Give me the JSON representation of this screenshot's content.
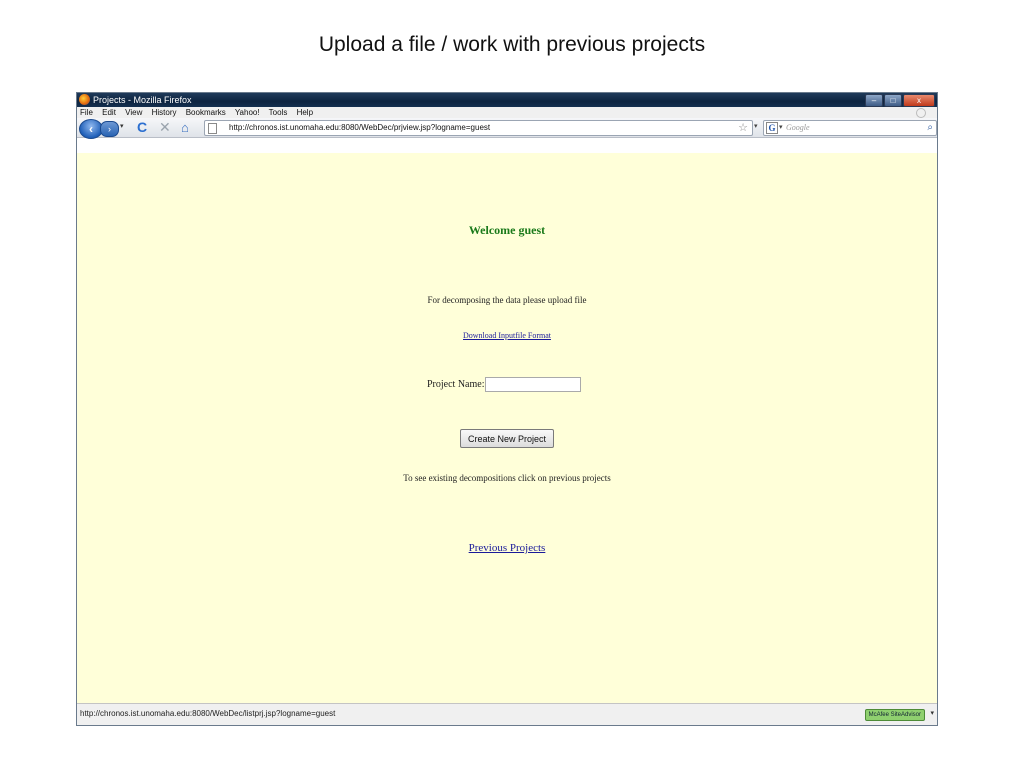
{
  "slide": {
    "title": "Upload a file / work with previous projects"
  },
  "window": {
    "title": "Projects - Mozilla Firefox",
    "controls": {
      "minimize": "–",
      "maximize": "□",
      "close": "x"
    }
  },
  "menubar": {
    "items": [
      "File",
      "Edit",
      "View",
      "History",
      "Bookmarks",
      "Yahoo!",
      "Tools",
      "Help"
    ]
  },
  "navbar": {
    "back": "‹",
    "forward": "›",
    "history": "▾",
    "reload": "C",
    "stop": "✕",
    "home": "⌂",
    "url": "http://chronos.ist.unomaha.edu:8080/WebDec/prjview.jsp?logname=guest",
    "bookmark_star": "☆",
    "url_dropdown": "▾",
    "search_engine": "G",
    "search_dropdown": "▾",
    "search_placeholder": "Google",
    "search_button": "⌕"
  },
  "page": {
    "welcome": "Welcome guest",
    "upload_text": "For decomposing the data please upload file",
    "download_link": "Download Inputfile Format",
    "project_name_label": "Project Name:",
    "project_name_value": "",
    "create_button": "Create New Project",
    "existing_text": "To see existing decompositions click on previous projects",
    "previous_link": "Previous Projects"
  },
  "statusbar": {
    "text": "http://chronos.ist.unomaha.edu:8080/WebDec/listprj.jsp?logname=guest",
    "mcafee": "McAfee SiteAdvisor",
    "mcafee_dropdown": "▾"
  },
  "colors": {
    "content_bg": "#ffffd9",
    "welcome": "#1a7a1a",
    "link": "#1a1a9a",
    "titlebar": "#0d2440"
  }
}
